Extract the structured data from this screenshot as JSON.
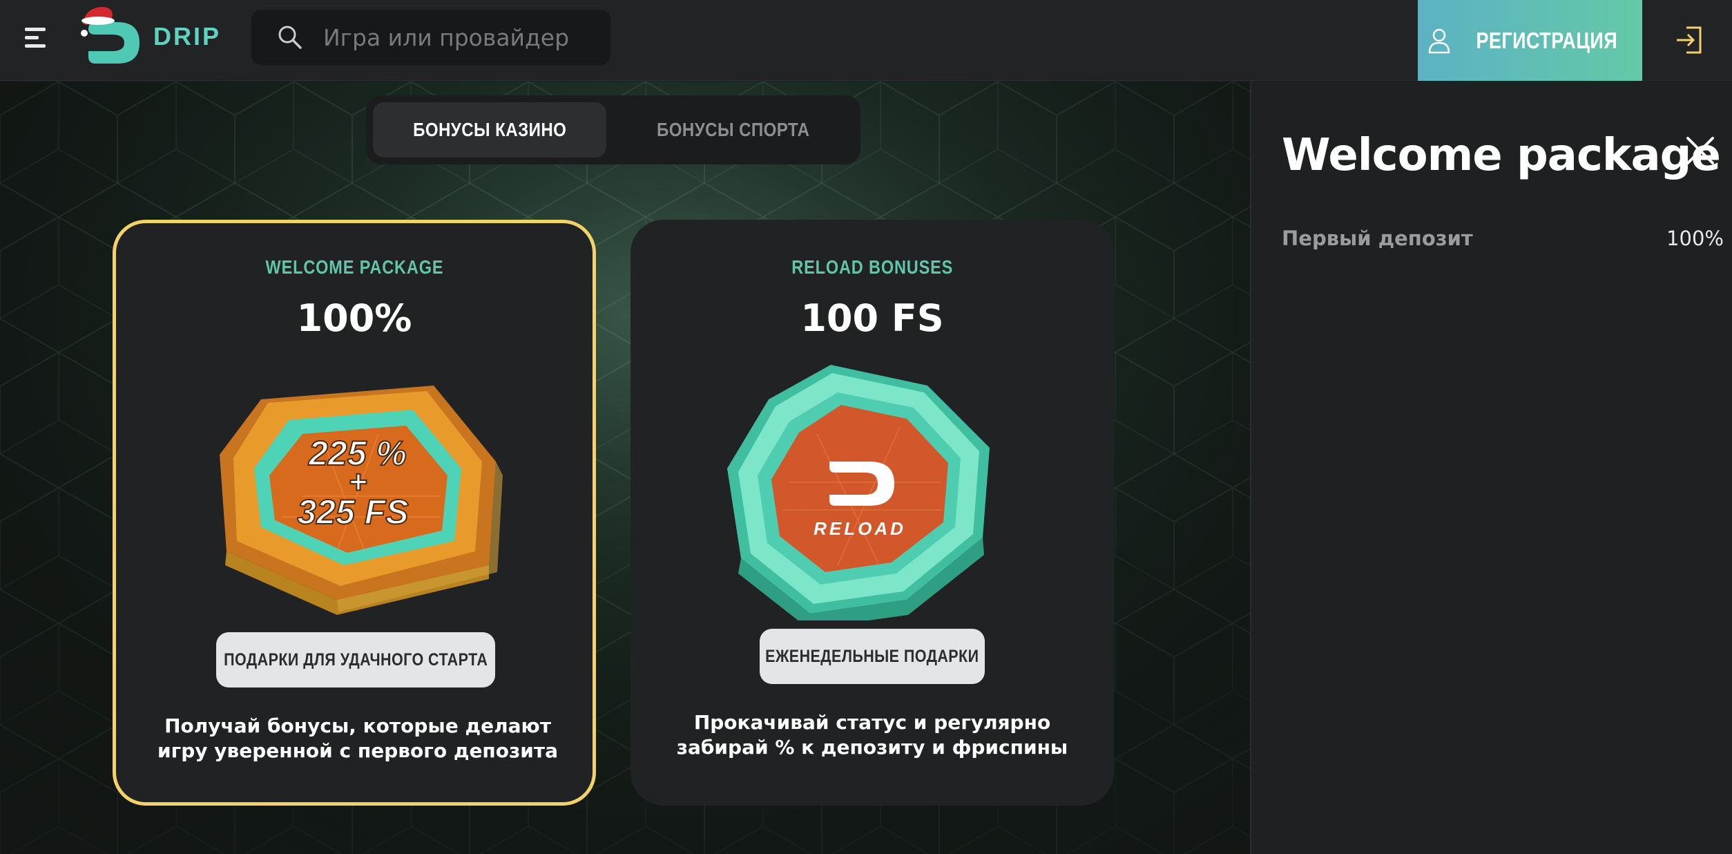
{
  "header": {
    "logo_text": "DRIP",
    "search": {
      "placeholder": "Игра или провайдер"
    },
    "register_label": "РЕГИСТРАЦИЯ"
  },
  "tabs": [
    {
      "label": "БОНУСЫ КАЗИНО",
      "active": true
    },
    {
      "label": "БОНУСЫ СПОРТА",
      "active": false
    }
  ],
  "cards": [
    {
      "subtitle": "WELCOME PACKAGE",
      "value": "100%",
      "art_text": [
        "225 %",
        "+",
        "325 FS"
      ],
      "button_label": "ПОДАРКИ ДЛЯ УДАЧНОГО СТАРТА",
      "description": "Получай бонусы, которые делают игру уверенной с первого депозита",
      "selected": true
    },
    {
      "subtitle": "RELOAD BONUSES",
      "value": "100 FS",
      "art_text": [
        "RELOAD"
      ],
      "button_label": "ЕЖЕНЕДЕЛЬНЫЕ ПОДАРКИ",
      "description": "Прокачивай статус и регулярно забирай % к депозиту и фриспины",
      "selected": false
    }
  ],
  "panel": {
    "title": "Welcome package",
    "rows": [
      {
        "label": "Первый депозит",
        "value": "100%"
      }
    ]
  },
  "colors": {
    "accent_teal": "#5fc6a8",
    "selected_border": "#f3d26a",
    "register_gradient_start": "#5cb2c4",
    "register_gradient_end": "#63c9a6"
  },
  "icons": [
    "menu-icon",
    "search-icon",
    "user-icon",
    "login-icon",
    "close-icon"
  ]
}
